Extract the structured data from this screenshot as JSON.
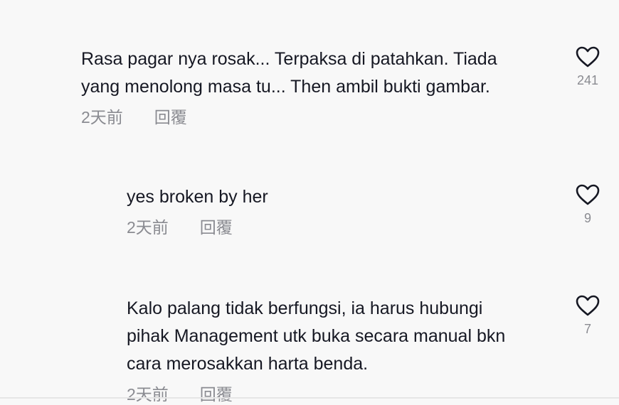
{
  "comments": [
    {
      "text": "Rasa pagar nya rosak... Terpaksa di patahkan. Tiada\nyang menolong masa tu... Then ambil bukti gambar.",
      "time": "2天前",
      "reply": "回覆",
      "likes": "241",
      "icon": "heart-outline-icon"
    },
    {
      "text": "yes broken by her",
      "time": "2天前",
      "reply": "回覆",
      "likes": "9",
      "icon": "heart-outline-icon"
    },
    {
      "text": "Kalo palang tidak berfungsi, ia harus hubungi\npihak Management utk buka secara manual bkn\ncara merosakkan harta benda.",
      "time": "2天前",
      "reply": "回覆",
      "likes": "7",
      "icon": "heart-outline-icon"
    }
  ],
  "colors": {
    "text": "#161823",
    "muted": "#8a8b91",
    "background": "#f8f8f8"
  }
}
